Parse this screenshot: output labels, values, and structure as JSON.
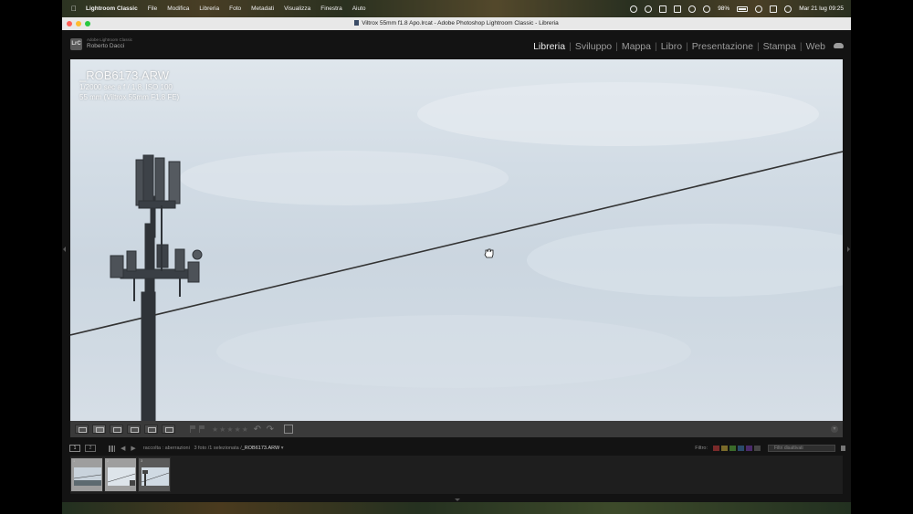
{
  "menubar": {
    "items": [
      "Lightroom Classic",
      "File",
      "Modifica",
      "Libreria",
      "Foto",
      "Metadati",
      "Visualizza",
      "Finestra",
      "Aiuto"
    ],
    "battery": "98%",
    "clock": "Mar 21 lug  09:25"
  },
  "window": {
    "title": "Viltrox 55mm f1.8 Apo.lrcat - Adobe Photoshop Lightroom Classic - Libreria"
  },
  "identity": {
    "product": "Adobe Lightroom Classic",
    "user": "Roberto Dacci",
    "logo": "LrC"
  },
  "modules": {
    "items": [
      "Libreria",
      "Sviluppo",
      "Mappa",
      "Libro",
      "Presentazione",
      "Stampa",
      "Web"
    ],
    "active": "Libreria"
  },
  "photo_overlay": {
    "filename": "_ROB6173.ARW",
    "exposure": "1/2000 sec a f / 1,8, ISO 100",
    "lens": "55 mm (Viltrox 55mm F1.8 FE)"
  },
  "toolbar": {
    "rating_stars": "★★★★★"
  },
  "filmstrip_header": {
    "monitor_1": "1",
    "monitor_2": "2",
    "source": "raccolta : aberrazioni",
    "count": "3 foto /1 selezionata /",
    "selected_file": "_ROB6173.ARW",
    "filter_label": "Filtro:",
    "filter_value": "Filtri disattivati",
    "swatch_colors": [
      "#7a2a2a",
      "#7a6a2a",
      "#3a6a2a",
      "#2a4a6a",
      "#4a2a6a",
      "#444444"
    ]
  },
  "filmstrip": {
    "thumbnails": [
      {
        "num": "1",
        "state": "selected"
      },
      {
        "num": "2",
        "state": "selected"
      },
      {
        "num": "3",
        "state": "active"
      }
    ]
  }
}
